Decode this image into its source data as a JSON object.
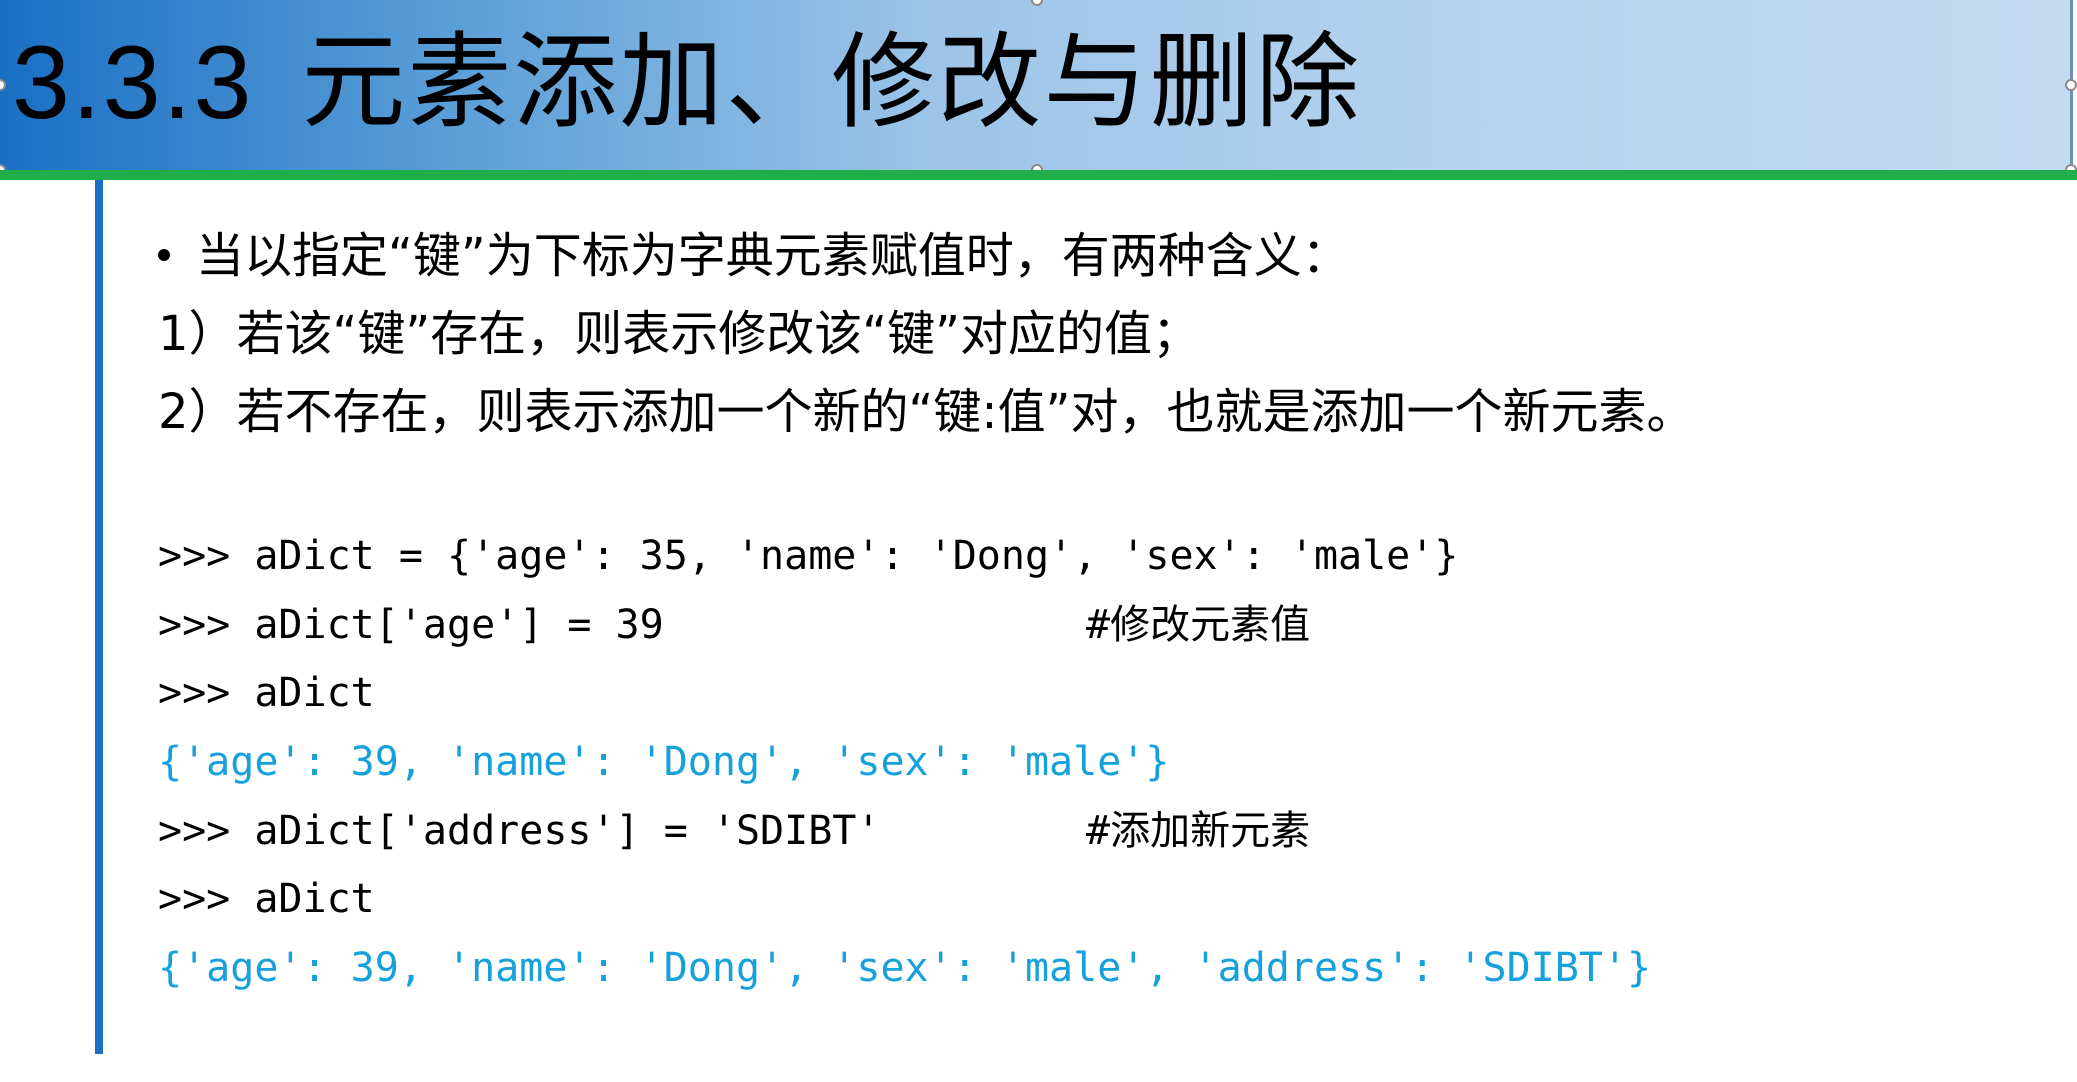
{
  "title": {
    "number": "3.3.3",
    "text": "元素添加、修改与删除"
  },
  "body": {
    "bullet": "当以指定“键”为下标为字典元素赋值时，有两种含义：",
    "line1": "1）若该“键”存在，则表示修改该“键”对应的值；",
    "line2": "2）若不存在，则表示添加一个新的“键:值”对，也就是添加一个新元素。"
  },
  "code": {
    "lines": [
      ">>> aDict = {'age': 35, 'name': 'Dong', 'sex': 'male'}",
      ">>> aDict['age'] = 39",
      ">>> aDict",
      "{'age': 39, 'name': 'Dong', 'sex': 'male'}",
      ">>> aDict['address'] = 'SDIBT'",
      ">>> aDict",
      "{'age': 39, 'name': 'Dong', 'sex': 'male', 'address': 'SDIBT'}"
    ],
    "comments": {
      "modify": "#修改元素值",
      "add": "#添加新元素"
    }
  },
  "colors": {
    "title_gradient_start": "#1a6fc4",
    "title_gradient_end": "#c2dbf1",
    "accent_line": "#1fae4a",
    "left_rule": "#1a6fc4",
    "output_text": "#16a0dc"
  }
}
